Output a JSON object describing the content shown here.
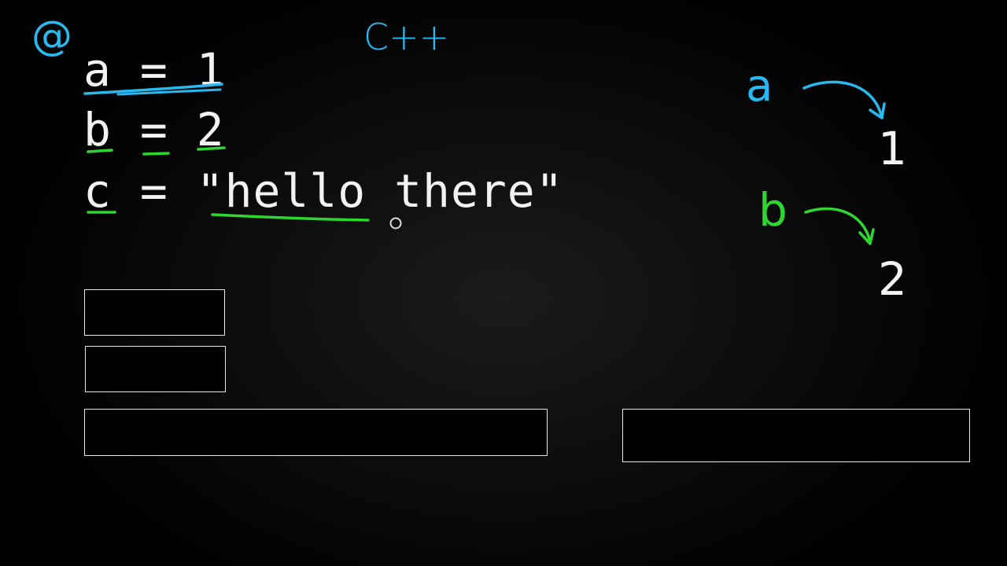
{
  "code_lines": [
    {
      "text": "a = 1"
    },
    {
      "text": "b = 2"
    },
    {
      "text": "c = \"hello there\""
    }
  ],
  "annotations": {
    "language": "C++",
    "diagram": {
      "a_label": "a",
      "a_value": "1",
      "b_label": "b",
      "b_value": "2"
    }
  },
  "colors": {
    "blue_ink": "#28b9f0",
    "green_ink": "#2fd62f",
    "text": "#f2f2f2",
    "background": "#000000"
  },
  "icons": [
    "at-sign-icon",
    "cursor-ring-icon"
  ]
}
